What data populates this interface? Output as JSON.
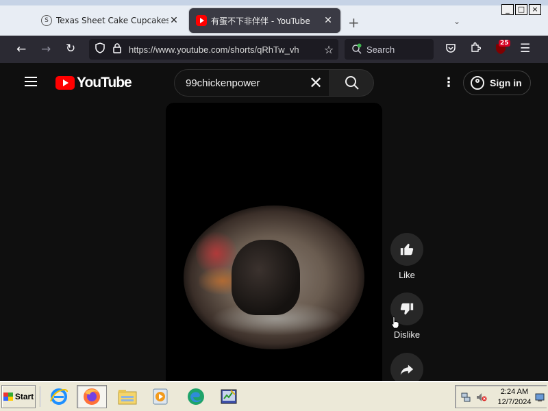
{
  "browser": {
    "tabs": [
      {
        "title": "Texas Sheet Cake Cupcakes Red",
        "favicon": "S",
        "active": false
      },
      {
        "title": "有蛋不下非伴伴 - YouTube",
        "active": true
      }
    ],
    "url": "https://www.youtube.com/shorts/qRhTw_vh",
    "search_placeholder": "Search",
    "extension_badge": "25",
    "window_buttons": [
      "_",
      "□",
      "×"
    ]
  },
  "youtube": {
    "logo_text": "YouTube",
    "search_query": "99chickenpower",
    "signin_label": "Sign in",
    "actions": [
      {
        "label": "Like",
        "icon": "thumbs-up-icon"
      },
      {
        "label": "Dislike",
        "icon": "thumbs-down-icon"
      },
      {
        "label": "",
        "icon": "share-icon"
      }
    ]
  },
  "taskbar": {
    "start_label": "Start",
    "apps": [
      "internet-explorer",
      "firefox",
      "file-explorer",
      "media-player",
      "edge",
      "task-manager"
    ],
    "clock_time": "2:24 AM",
    "clock_date": "12/7/2024"
  },
  "colors": {
    "youtube_red": "#ff0000",
    "browser_toolbar": "#2b2a33",
    "page_bg": "#0f0f0f",
    "taskbar": "#ece9d8"
  }
}
